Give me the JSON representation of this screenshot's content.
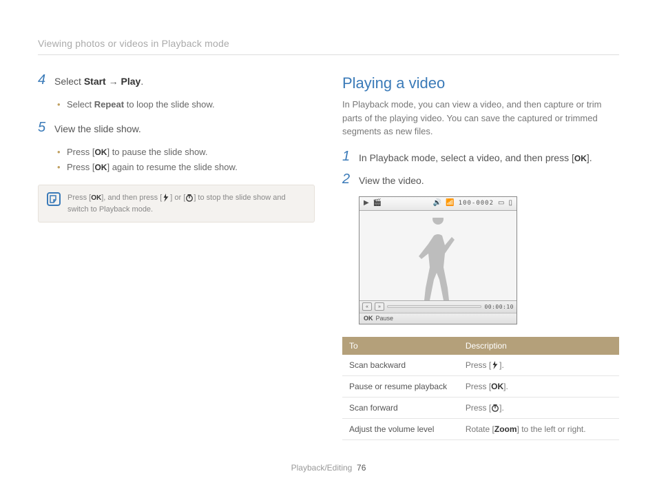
{
  "breadcrumb": "Viewing photos or videos in Playback mode",
  "left": {
    "step4": {
      "num": "4",
      "pre": "Select ",
      "b1": "Start",
      "mid": " → ",
      "b2": "Play",
      "post": ".",
      "bullets": [
        {
          "pre": "Select ",
          "b": "Repeat",
          "post": " to loop the slide show."
        }
      ]
    },
    "step5": {
      "num": "5",
      "text": "View the slide show.",
      "bullets": [
        {
          "pre": "Press [",
          "icon": "ok",
          "post": "] to pause the slide show."
        },
        {
          "pre": "Press [",
          "icon": "ok",
          "post": "] again to resume the slide show."
        }
      ]
    },
    "note": {
      "p1": "Press [",
      "p2": "], and then press [",
      "p3": "] or [",
      "p4": "] to stop the slide show and switch to Playback mode."
    }
  },
  "right": {
    "title": "Playing a video",
    "desc": "In Playback mode, you can view a video, and then capture or trim parts of the playing video. You can save the captured or trimmed segments as new files.",
    "step1": {
      "num": "1",
      "pre": "In Playback mode, select a video, and then press [",
      "post": "]."
    },
    "step2": {
      "num": "2",
      "text": "View the video."
    },
    "video": {
      "counter": "100-0002",
      "time": "00:00:10",
      "caption_label": "Pause"
    },
    "table": {
      "h1": "To",
      "h2": "Description",
      "rows": [
        {
          "to": "Scan backward",
          "d_pre": "Press [",
          "icon": "flash",
          "d_post": "]."
        },
        {
          "to": "Pause or resume playback",
          "d_pre": "Press [",
          "icon": "ok",
          "d_post": "]."
        },
        {
          "to": "Scan forward",
          "d_pre": "Press [",
          "icon": "timer",
          "d_post": "]."
        },
        {
          "to": "Adjust the volume level",
          "d_pre": "Rotate [",
          "b": "Zoom",
          "d_post": "] to the left or right."
        }
      ]
    }
  },
  "footer": {
    "section": "Playback/Editing",
    "page": "76"
  }
}
